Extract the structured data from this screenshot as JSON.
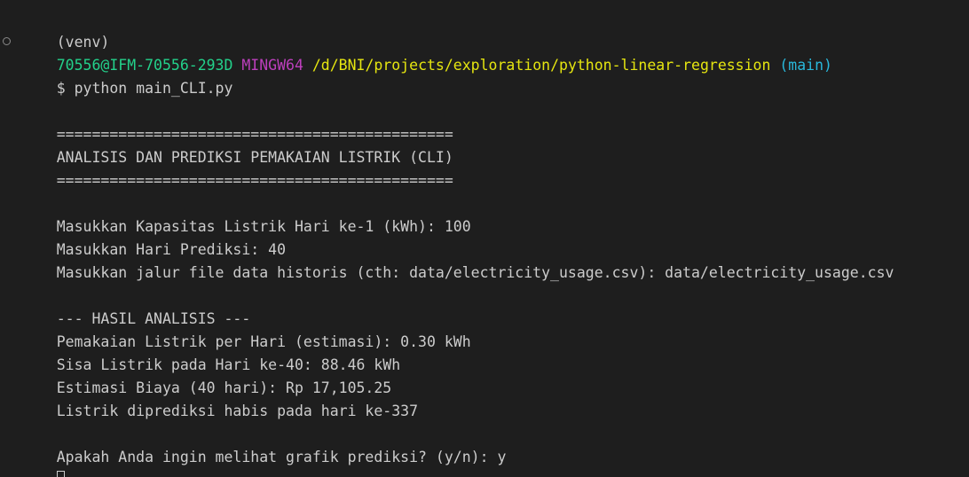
{
  "colors": {
    "background": "#1e1e1e",
    "text": "#cccccc",
    "user_host": "#23d18b",
    "msystem": "#bc3fbc",
    "path": "#e5e510",
    "branch": "#29b8db"
  },
  "prompt": {
    "venv": "(venv)",
    "user_host": "70556@IFM-70556-293D",
    "msystem": "MINGW64",
    "path": "/d/BNI/projects/exploration/python-linear-regression",
    "branch": "(main)",
    "command": "$ python main_CLI.py"
  },
  "output": {
    "rule_top": "=============================================",
    "title": "ANALISIS DAN PREDIKSI PEMAKAIAN LISTRIK (CLI)",
    "rule_bottom": "=============================================",
    "input_capacity": "Masukkan Kapasitas Listrik Hari ke-1 (kWh): 100",
    "input_days": "Masukkan Hari Prediksi: 40",
    "input_file": "Masukkan jalur file data historis (cth: data/electricity_usage.csv): data/electricity_usage.csv",
    "result_header": "--- HASIL ANALISIS ---",
    "daily_usage": "Pemakaian Listrik per Hari (estimasi): 0.30 kWh",
    "remaining": "Sisa Listrik pada Hari ke-40: 88.46 kWh",
    "cost": "Estimasi Biaya (40 hari): Rp 17,105.25",
    "depleted": "Listrik diprediksi habis pada hari ke-337",
    "graph_prompt": "Apakah Anda ingin melihat grafik prediksi? (y/n): y"
  }
}
